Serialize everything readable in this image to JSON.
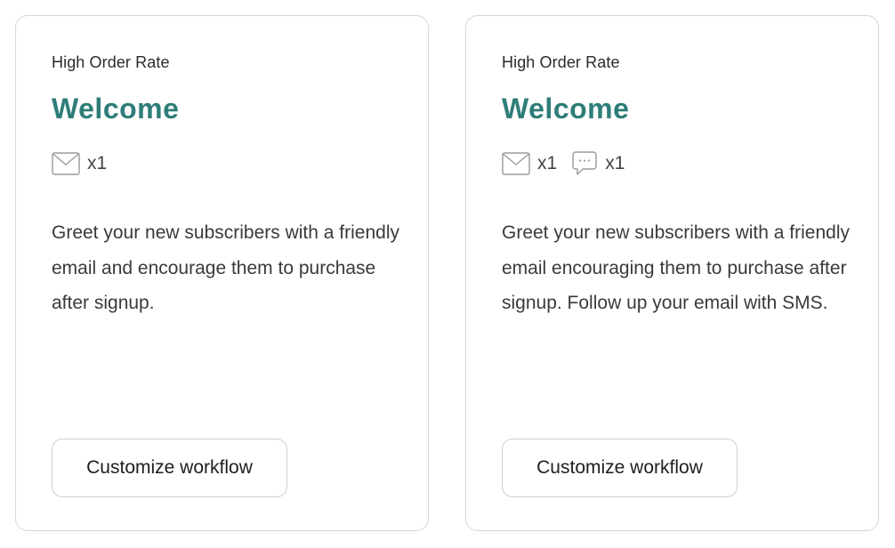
{
  "cards": [
    {
      "eyebrow": "High Order Rate",
      "title": "Welcome",
      "channels": [
        {
          "icon": "email-icon",
          "count": "x1"
        }
      ],
      "description": "Greet your new subscribers with a friendly email and encourage them to purchase after signup.",
      "button_label": "Customize workflow"
    },
    {
      "eyebrow": "High Order Rate",
      "title": "Welcome",
      "channels": [
        {
          "icon": "email-icon",
          "count": "x1"
        },
        {
          "icon": "sms-icon",
          "count": "x1"
        }
      ],
      "description": "Greet your new subscribers with a friendly email encouraging them to purchase after signup. Follow up your email with SMS.",
      "button_label": "Customize workflow"
    }
  ],
  "colors": {
    "title": "#2e7d78",
    "border": "#d6d6d6",
    "text": "#3a3a3a"
  }
}
